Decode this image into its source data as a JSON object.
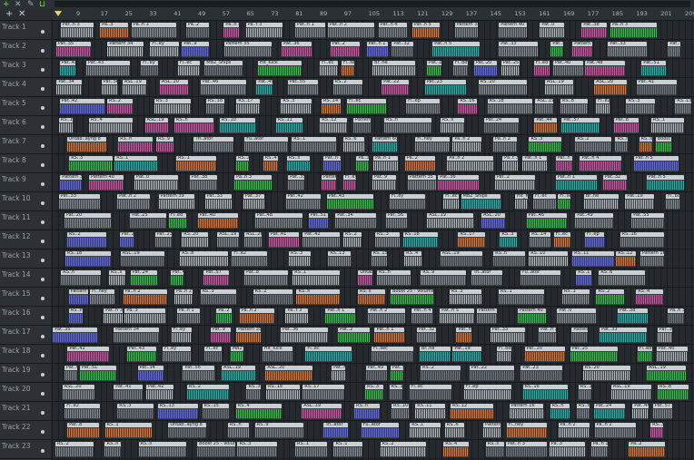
{
  "app": {
    "toolbar": {
      "icons": [
        "add-icon",
        "close-icon",
        "pencil-icon",
        "draw-icon"
      ],
      "glyphs": [
        "+",
        "✕",
        "✎",
        "⊔"
      ]
    },
    "header_buttons": {
      "add": "+",
      "close": "✕"
    },
    "tracks": [
      "Track 1",
      "Track 2",
      "Track 3",
      "Track 4",
      "Track 5",
      "Track 6",
      "Track 7",
      "Track 8",
      "Track 9",
      "Track 10",
      "Track 11",
      "Track 12",
      "Track 13",
      "Track 14",
      "Track 15",
      "Track 16",
      "Track 17",
      "Track 18",
      "Track 19",
      "Track 20",
      "Track 21",
      "Track 22",
      "Track 23"
    ],
    "ruler_bars": [
      "9",
      "17",
      "25",
      "33",
      "41",
      "49",
      "57",
      "65",
      "73",
      "81",
      "89",
      "97",
      "105",
      "113",
      "121",
      "129",
      "137",
      "145",
      "153",
      "161",
      "169",
      "177",
      "185",
      "193",
      "201",
      "209"
    ],
    "colors": {
      "background": "#262a2e",
      "header": "#2d3136",
      "clip_grey": "#c9cfd2",
      "green": "#59c267",
      "pink": "#c86aa8",
      "orange": "#d98a5c",
      "blue": "#6e74d6",
      "teal": "#4bb3b0",
      "playhead": "#e8d26a"
    },
    "clip_labels": [
      "Pat..n 3",
      "Pa..3",
      "Pa..n 1",
      "Pa..2",
      "Pa..n 2",
      "Pa..t 3",
      "Pat..n 1",
      "Pat..n 2",
      "Pat..n 4",
      "Pat..n 5",
      "Pattern 33",
      "Pattern 40",
      "Pat..0",
      "Pat..38",
      "Pa..n 3",
      "Pat..35",
      "Pattern 34",
      "Fl..ey",
      "Pat..9",
      "Pattern 35",
      "Pat..36",
      "Pat..2",
      "Pat..n 1",
      "Pat..32",
      "Pat..n 5",
      "Pat..33",
      "Pat..n 2",
      "Pattern 39",
      "Pat..33",
      "Pat..37",
      "Pat..42",
      "Pat..43",
      "Fl..ey",
      "Fl..ec",
      "MB2_Snips",
      "Hit_Kick",
      "Fl..ec",
      "Fl..sec",
      "Br..ne",
      "Pat..19",
      "Fl..bd",
      "Pat..20",
      "Pat..25",
      "Fl..ed",
      "Pat..40",
      "Pat..48",
      "Pat..51",
      "Pat..34",
      "Pat..56",
      "ASL..19",
      "ASL..20",
      "Pat..46",
      "Pat..49",
      "Pat..55",
      "RS..2",
      "Pat..22",
      "Pat..23",
      "RS..20",
      "ASL..19",
      "ASL..20",
      "Pat..41",
      "Pat..42",
      "RS..2",
      "RS..3",
      "RS..18",
      "RS..17",
      "RS..3",
      "RS..14",
      "Fl..ec",
      "Fl..ep",
      "RS..16",
      "RS..18",
      "ASL..19",
      "RS..8",
      "Fl..e2",
      "RS..3",
      "RS..13",
      "RS..15",
      "RS..4",
      "ASL..19",
      "RS..n",
      "RS..10",
      "RS..11",
      "RS..12",
      "Pattern 16",
      "RS..n",
      "RS..s",
      "Pat..24",
      "Pat..44",
      "Pat..57",
      "Pat..8",
      "RS..1",
      "Untab..ayng 8",
      "RS..n",
      "RS..9",
      "Tri..ator",
      "Fu..ator",
      "RS..1",
      "RS..6",
      "Pattern 60",
      "Fl..ney",
      "Pa..n 2",
      "Pa..n 2",
      "RS..3",
      "RS..2",
      "RS..n",
      "RS..s",
      "Boost 25 - Volume",
      "RS..3",
      "RS..1",
      "RS..1",
      "RS..2",
      "RS..4",
      "RS..s"
    ]
  }
}
